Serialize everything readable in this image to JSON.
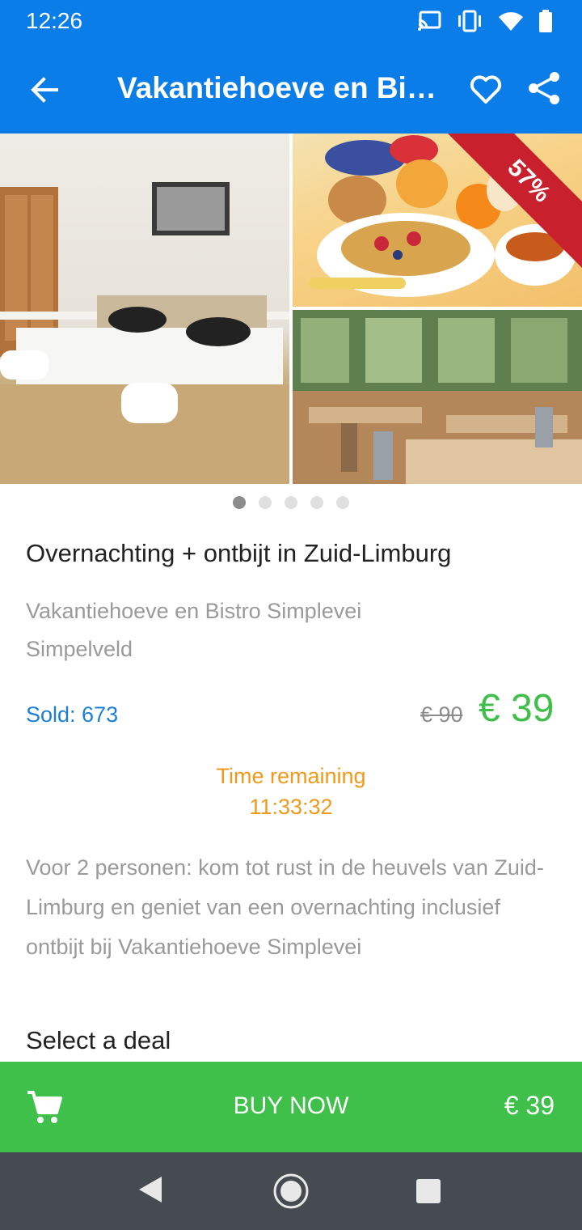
{
  "status_bar": {
    "time": "12:26",
    "icons": [
      "cast-icon",
      "vibrate-icon",
      "wifi-icon",
      "battery-icon"
    ]
  },
  "app_bar": {
    "title": "Vakantiehoeve en Bistro Simplevei",
    "icons": [
      "back-arrow-icon",
      "heart-icon",
      "share-icon"
    ]
  },
  "gallery": {
    "discount_badge": "57%",
    "photos": [
      "bedroom-photo",
      "breakfast-photo",
      "restaurant-photo"
    ],
    "page_count": 5,
    "active_page": 1
  },
  "deal": {
    "title": "Overnachting + ontbijt in Zuid-Limburg",
    "venue": "Vakantiehoeve en Bistro Simplevei",
    "city": "Simpelveld",
    "sold": "Sold: 673",
    "old_price": "€ 90",
    "price": "€ 39",
    "time_label": "Time remaining",
    "time_value": "11:33:32",
    "description": "Voor 2 personen: kom tot rust in de heuvels van Zuid-Limburg en geniet van een overnachting inclusief ontbijt bij Vakantiehoeve Simplevei",
    "select_heading": "Select a deal"
  },
  "buy_bar": {
    "label": "BUY NOW",
    "price": "€ 39",
    "icon": "cart-icon"
  },
  "colors": {
    "primary": "#0a7de8",
    "buy_green": "#3fc04a",
    "price_green": "#3fbf49",
    "timer_orange": "#ef9a1a",
    "sold_blue": "#1a7fd6",
    "badge_red": "#c8202c",
    "nav_gray": "#454b50"
  }
}
